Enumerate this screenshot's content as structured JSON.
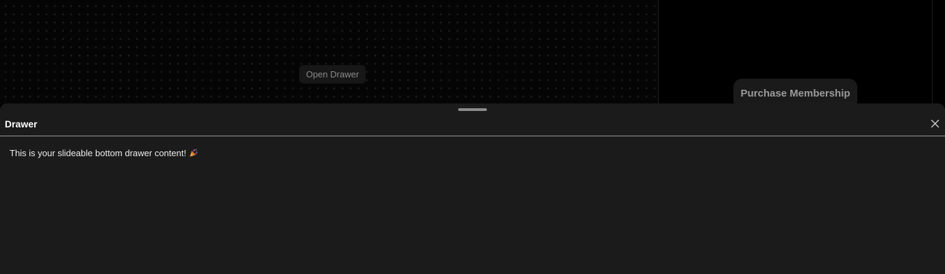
{
  "preview": {
    "open_drawer_label": "Open Drawer",
    "purchase_label": "Purchase Membership"
  },
  "drawer": {
    "title": "Drawer",
    "content": "This is your slideable bottom drawer content!",
    "content_emoji_icon": "party-popper-icon",
    "close_icon": "close-icon"
  },
  "colors": {
    "background": "#000000",
    "drawer_background": "#1b1b1b",
    "text_primary": "#ffffff",
    "button_background": "#171717",
    "button_text": "#8a8a8a"
  }
}
